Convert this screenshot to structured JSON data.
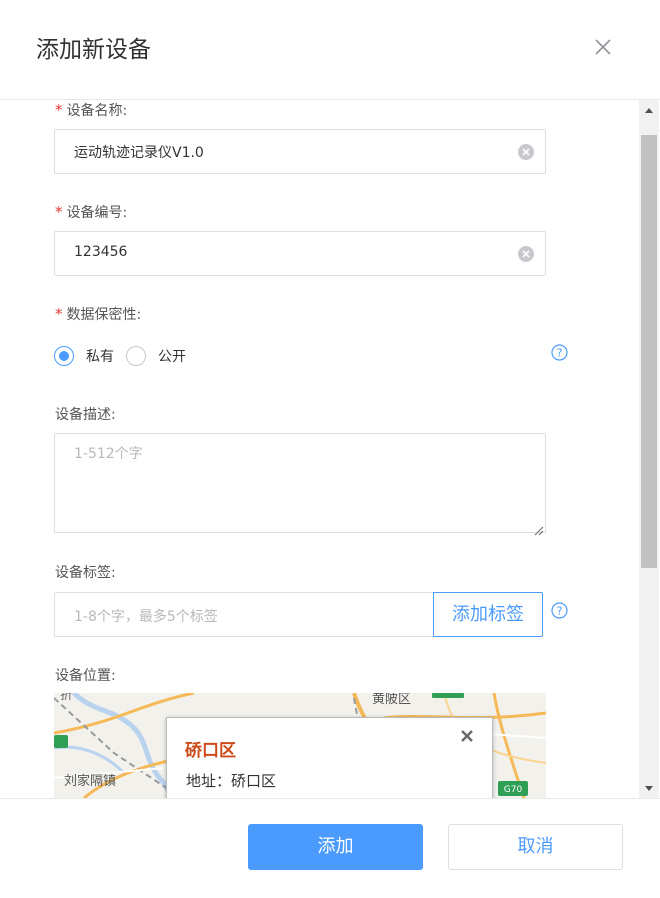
{
  "dialog": {
    "title": "添加新设备"
  },
  "form": {
    "required_mark": "*",
    "device_name": {
      "label": "设备名称:",
      "value": "运动轨迹记录仪V1.0"
    },
    "device_number": {
      "label": "设备编号:",
      "value": "123456"
    },
    "privacy": {
      "label": "数据保密性:",
      "options": [
        "私有",
        "公开"
      ],
      "selected": "私有"
    },
    "description": {
      "label": "设备描述:",
      "placeholder": "1-512个字"
    },
    "tags": {
      "label": "设备标签:",
      "placeholder": "1-8个字，最多5个标签",
      "add_button": "添加标签"
    },
    "location": {
      "label": "设备位置:",
      "map": {
        "place_labels": [
          "黄陂区",
          "刘家隔镇"
        ],
        "road_shields": [
          "G70"
        ],
        "popup_title": "硚口区",
        "popup_address": "地址：硚口区"
      }
    }
  },
  "footer": {
    "confirm_label": "添加",
    "cancel_label": "取消"
  },
  "colors": {
    "accent": "#4b9bff",
    "required": "#e53935",
    "popup_title": "#cc4b1a"
  },
  "icons": {
    "close": "close-icon",
    "clear": "clear-icon",
    "help": "help-icon"
  }
}
